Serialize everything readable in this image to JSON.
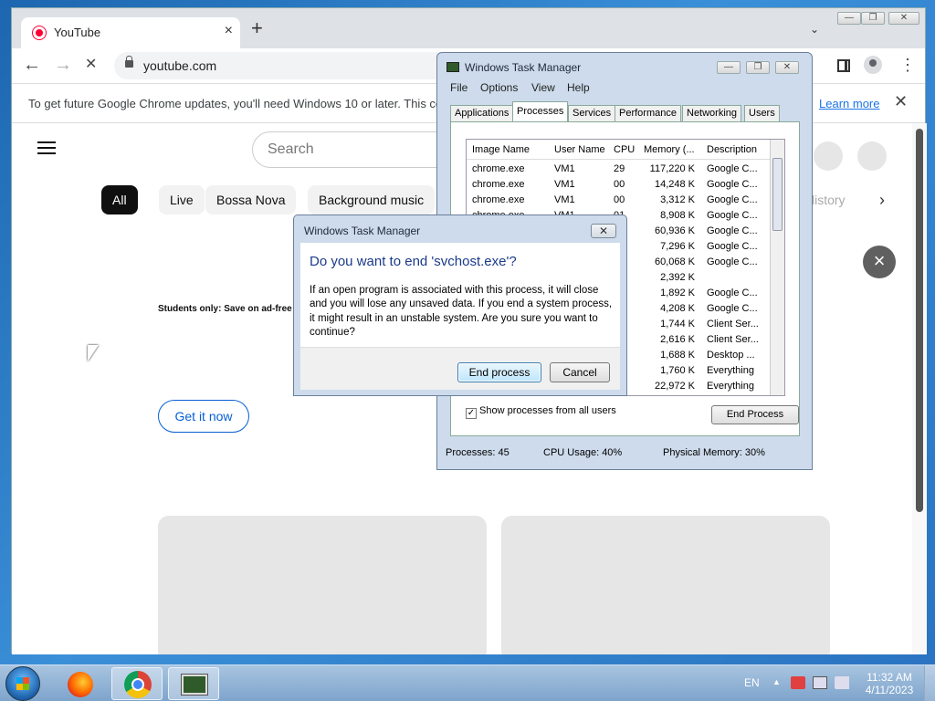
{
  "browser": {
    "tab_title": "YouTube",
    "tab_close": "×",
    "new_tab": "+",
    "tab_search": "⌄",
    "url": "youtube.com",
    "reload_stop": "✕",
    "infobar_text": "To get future Google Chrome updates, you'll need Windows 10 or later. This computer is using Windows 7.",
    "learn_more": "Learn more",
    "infobar_close": "✕",
    "menu": "⋮"
  },
  "youtube": {
    "search_placeholder": "Search",
    "chips": [
      "All",
      "Live",
      "Bossa Nova",
      "Background music"
    ],
    "chip_partial": "listory",
    "chip_next": "›",
    "promo_text": "Students only: Save on ad-free",
    "get_it_now": "Get it now",
    "promo_close": "×"
  },
  "task_manager": {
    "title": "Windows Task Manager",
    "menu": [
      "File",
      "Options",
      "View",
      "Help"
    ],
    "tabs": [
      "Applications",
      "Processes",
      "Services",
      "Performance",
      "Networking",
      "Users"
    ],
    "active_tab": "Processes",
    "columns": [
      "Image Name",
      "User Name",
      "CPU",
      "Memory (...",
      "Description"
    ],
    "rows": [
      [
        "chrome.exe",
        "VM1",
        "29",
        "117,220 K",
        "Google C..."
      ],
      [
        "chrome.exe",
        "VM1",
        "00",
        "14,248 K",
        "Google C..."
      ],
      [
        "chrome.exe",
        "VM1",
        "00",
        "3,312 K",
        "Google C..."
      ],
      [
        "chrome.exe",
        "VM1",
        "01",
        "8,908 K",
        "Google C..."
      ],
      [
        "",
        "",
        "",
        "60,936 K",
        "Google C..."
      ],
      [
        "",
        "",
        "",
        "7,296 K",
        "Google C..."
      ],
      [
        "",
        "",
        "",
        "60,068 K",
        "Google C..."
      ],
      [
        "",
        "",
        "",
        "2,392 K",
        ""
      ],
      [
        "",
        "",
        "",
        "1,892 K",
        "Google C..."
      ],
      [
        "",
        "",
        "",
        "4,208 K",
        "Google C..."
      ],
      [
        "",
        "",
        "",
        "1,744 K",
        "Client Ser..."
      ],
      [
        "",
        "",
        "",
        "2,616 K",
        "Client Ser..."
      ],
      [
        "",
        "",
        "",
        "1,688 K",
        "Desktop ..."
      ],
      [
        "",
        "",
        "",
        "1,760 K",
        "Everything"
      ],
      [
        "",
        "",
        "",
        "22,972 K",
        "Everything"
      ]
    ],
    "show_all_label": "Show processes from all users",
    "show_all_checked": "✓",
    "end_process_btn": "End Process",
    "status": {
      "processes": "Processes: 45",
      "cpu": "CPU Usage: 40%",
      "memory": "Physical Memory: 30%"
    }
  },
  "dialog": {
    "title": "Windows Task Manager",
    "close": "✕",
    "heading": "Do you want to end 'svchost.exe'?",
    "message": "If an open program is associated with this process, it will close and you will lose any unsaved data. If you end a system process, it might result in an unstable system. Are you sure you want to continue?",
    "end_process": "End process",
    "cancel": "Cancel"
  },
  "taskbar": {
    "language": "EN",
    "tray_up": "▲",
    "time": "11:32 AM",
    "date": "4/11/2023"
  }
}
